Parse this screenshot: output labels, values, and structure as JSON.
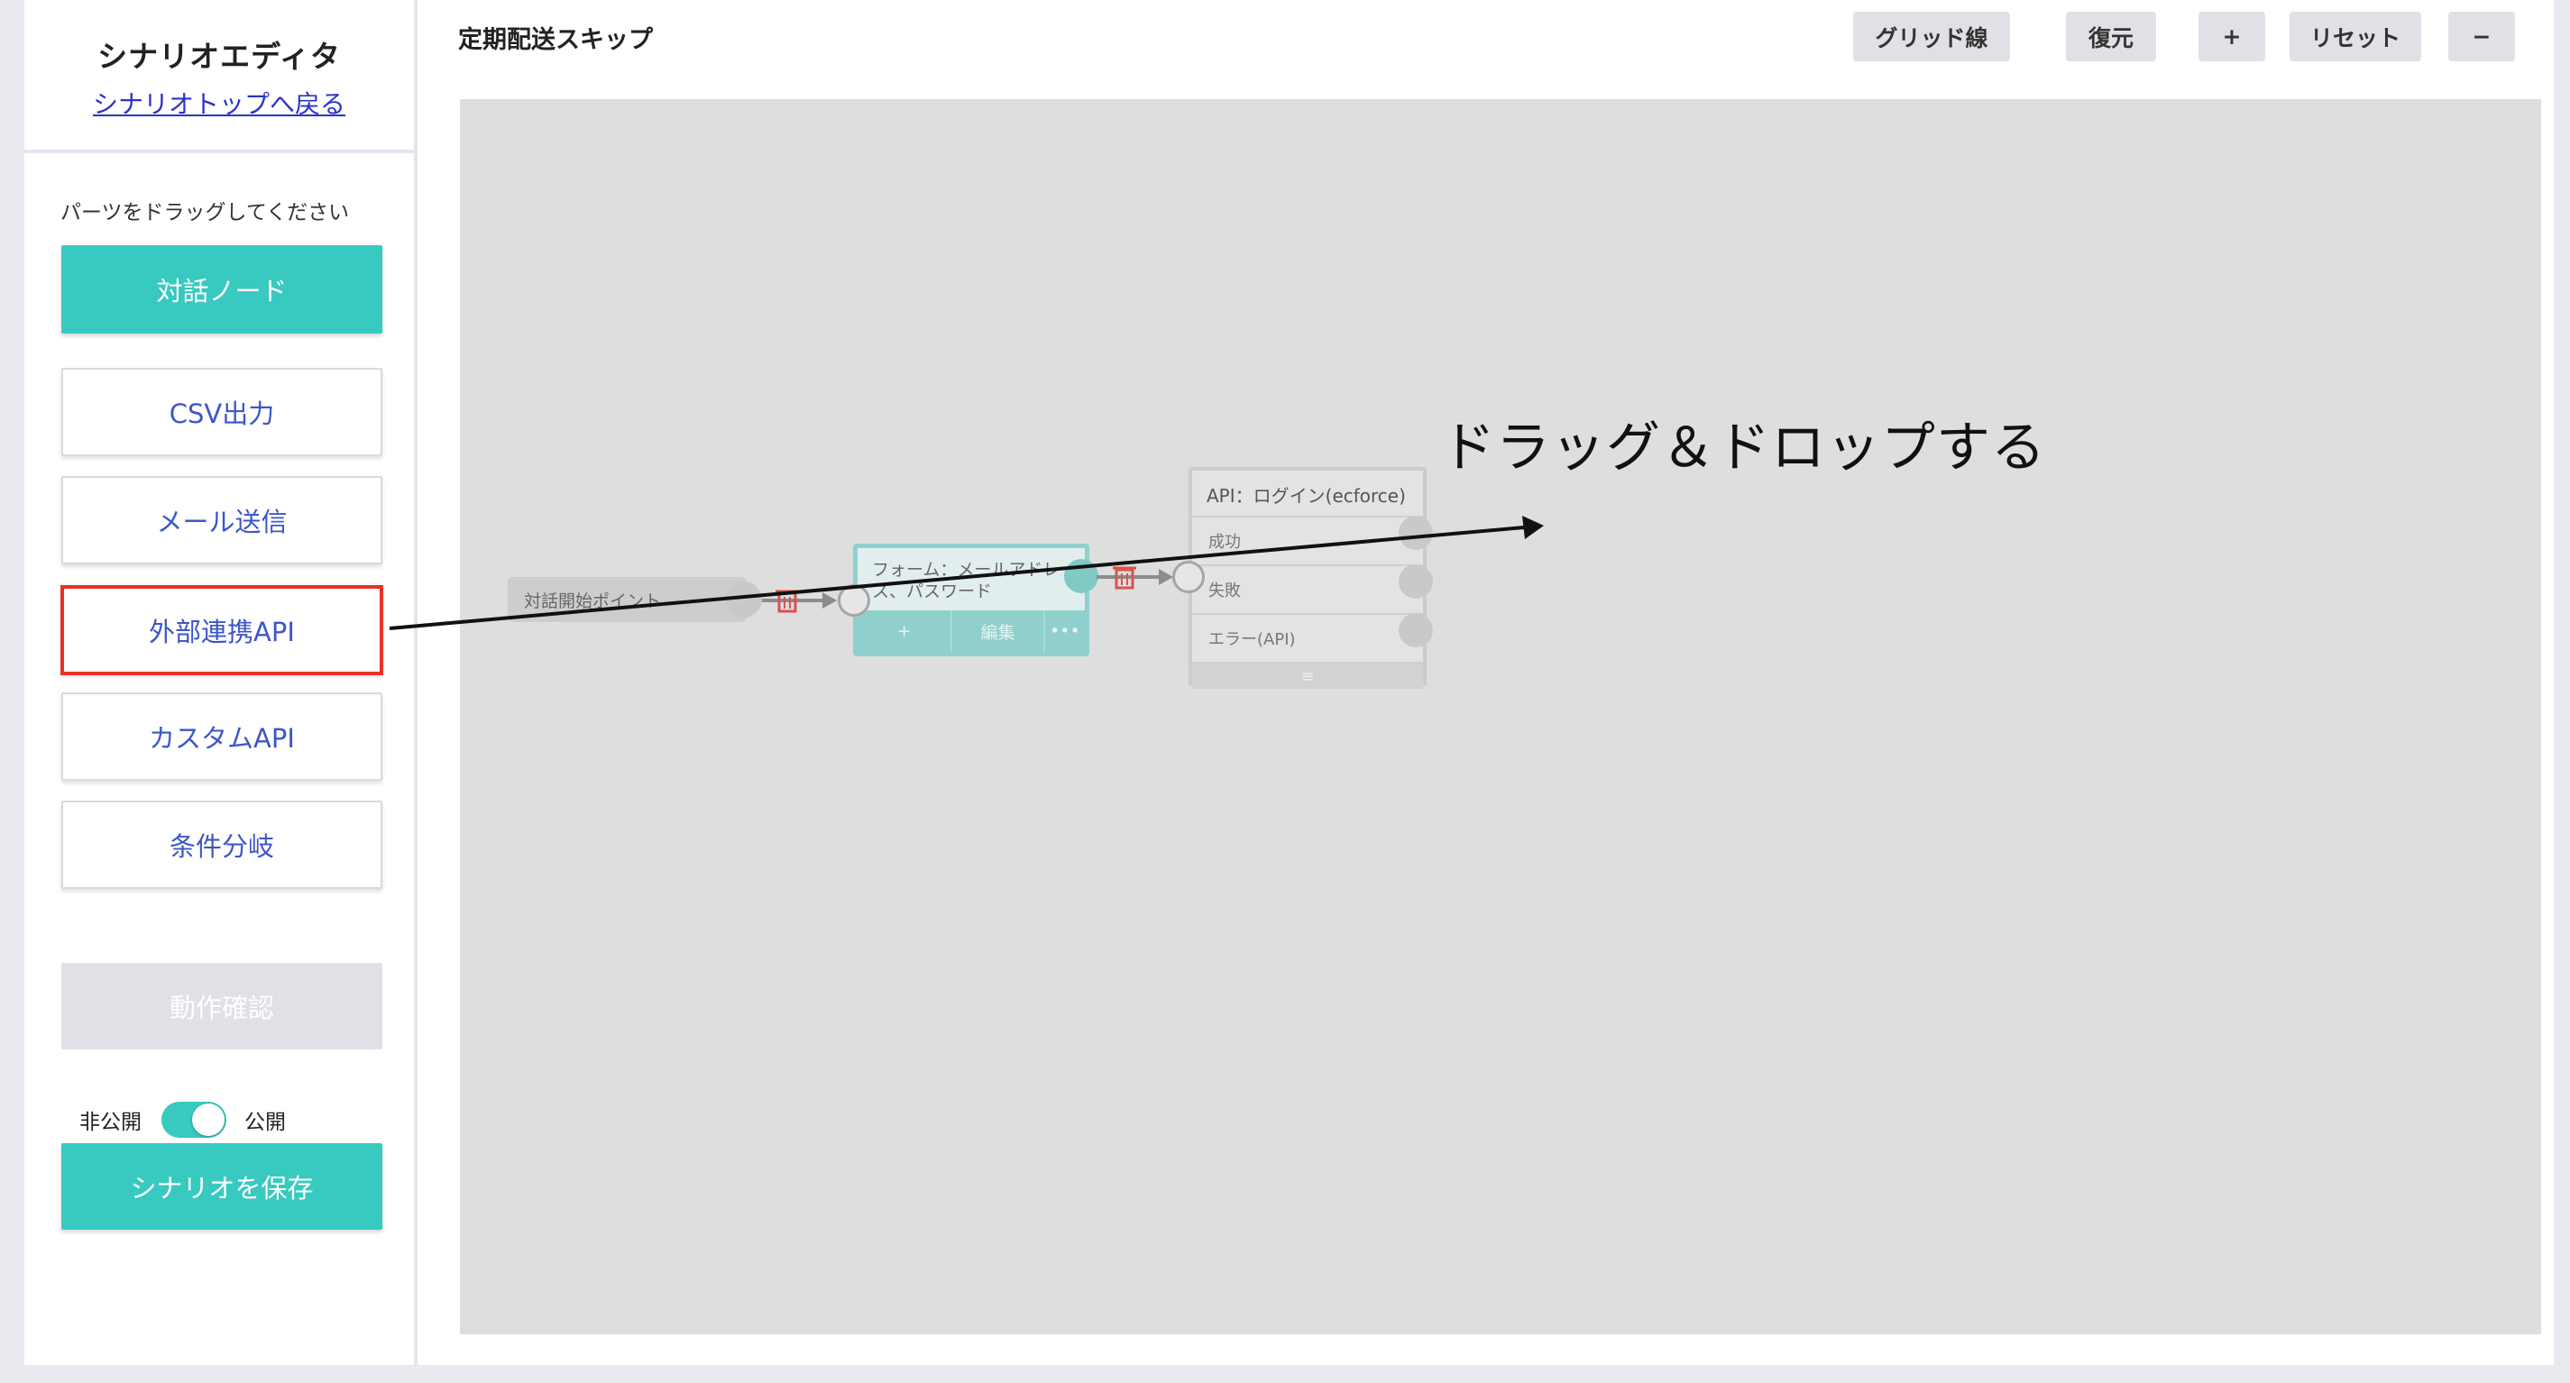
{
  "sidebar": {
    "title": "シナリオエディタ",
    "back_link": "シナリオトップへ戻る",
    "hint": "パーツをドラッグしてください",
    "parts": [
      {
        "label": "対話ノード"
      },
      {
        "label": "CSV出力"
      },
      {
        "label": "メール送信"
      },
      {
        "label": "外部連携API"
      },
      {
        "label": "カスタムAPI"
      },
      {
        "label": "条件分岐"
      }
    ],
    "test_button": "動作確認",
    "toggle": {
      "off_label": "非公開",
      "on_label": "公開",
      "state": "on"
    },
    "save_button": "シナリオを保存"
  },
  "header": {
    "title": "定期配送スキップ",
    "toolbar": {
      "grid": "グリッド線",
      "restore": "復元",
      "zoom_in": "+",
      "reset": "リセット",
      "zoom_out": "−"
    }
  },
  "canvas": {
    "start_node": "対話開始ポイント",
    "form_node": {
      "line1": "フォーム：メールアドレ",
      "line2": "ス、パスワード",
      "add": "+",
      "edit": "編集",
      "more": "•••"
    },
    "api_node": {
      "title": "API：ログイン(ecforce)",
      "outputs": [
        "成功",
        "失敗",
        "エラー(API)"
      ],
      "footer": "≡"
    },
    "annotation": "ドラッグ＆ドロップする"
  },
  "colors": {
    "accent": "#38c9c0",
    "link": "#3d56c8",
    "highlight": "#e63324"
  }
}
